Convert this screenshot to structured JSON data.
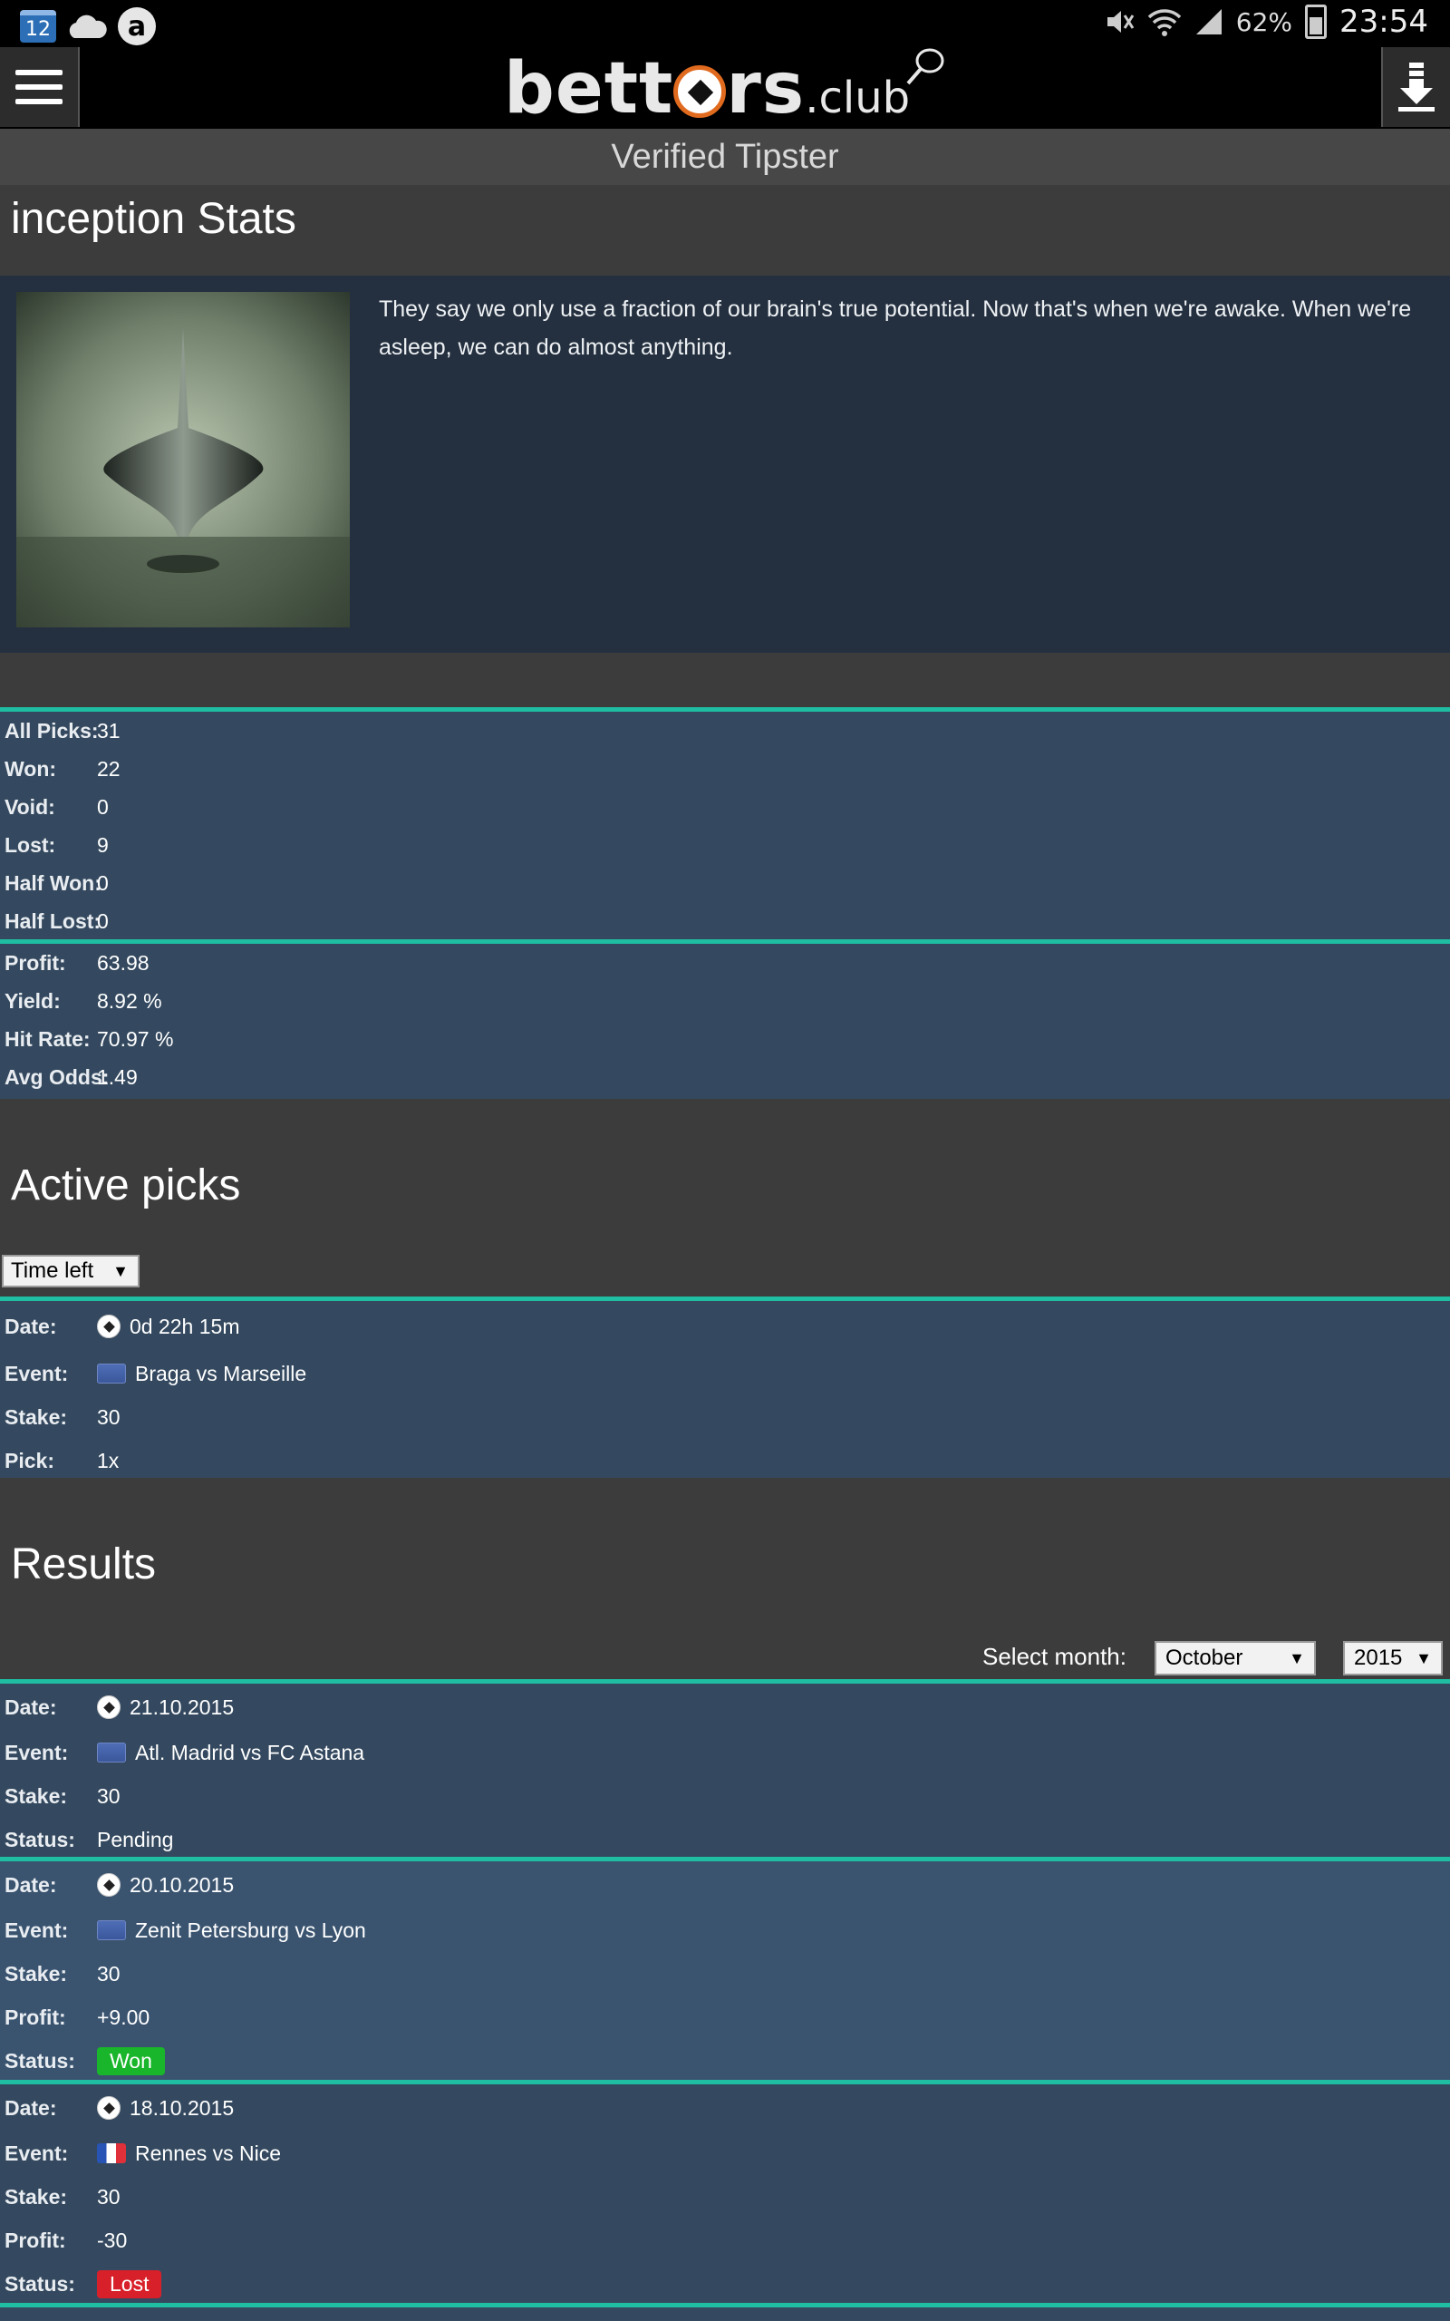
{
  "status_bar": {
    "calendar_day": "12",
    "battery": "62%",
    "time": "23:54"
  },
  "header": {
    "logo_text": "bett",
    "logo_rest": "rs",
    "logo_club": ".club"
  },
  "page": {
    "banner": "Verified Tipster",
    "title": "inception Stats"
  },
  "profile": {
    "bio": "They say we only use a fraction of our brain's true potential. Now that's when we're awake. When we're asleep, we can do almost anything."
  },
  "stats": {
    "picks": [
      {
        "label": "All Picks:",
        "value": "31"
      },
      {
        "label": "Won:",
        "value": "22"
      },
      {
        "label": "Void:",
        "value": "0"
      },
      {
        "label": "Lost:",
        "value": "9"
      },
      {
        "label": "Half Won:",
        "value": "0"
      },
      {
        "label": "Half Lost:",
        "value": "0"
      }
    ],
    "performance": [
      {
        "label": "Profit:",
        "value": "63.98"
      },
      {
        "label": "Yield:",
        "value": "8.92 %"
      },
      {
        "label": "Hit Rate:",
        "value": "70.97 %"
      },
      {
        "label": "Avg Odds:",
        "value": "1.49"
      }
    ]
  },
  "active": {
    "heading": "Active picks",
    "sort_select": "Time left",
    "pick": {
      "date_label": "Date:",
      "date": "0d 22h 15m",
      "event_label": "Event:",
      "event": "Braga vs Marseille",
      "stake_label": "Stake:",
      "stake": "30",
      "pick_label": "Pick:",
      "pick": "1x"
    }
  },
  "results": {
    "heading": "Results",
    "select_month_label": "Select month:",
    "month": "October",
    "year": "2015",
    "items": [
      {
        "date_label": "Date:",
        "date": "21.10.2015",
        "event_label": "Event:",
        "event": "Atl. Madrid vs FC Astana",
        "stake_label": "Stake:",
        "stake": "30",
        "status_label": "Status:",
        "status": "Pending"
      },
      {
        "date_label": "Date:",
        "date": "20.10.2015",
        "event_label": "Event:",
        "event": "Zenit Petersburg vs Lyon",
        "stake_label": "Stake:",
        "stake": "30",
        "profit_label": "Profit:",
        "profit": "+9.00",
        "status_label": "Status:",
        "status": "Won"
      },
      {
        "date_label": "Date:",
        "date": "18.10.2015",
        "event_label": "Event:",
        "event": "Rennes vs Nice",
        "stake_label": "Stake:",
        "stake": "30",
        "profit_label": "Profit:",
        "profit": "-30",
        "status_label": "Status:",
        "status": "Lost"
      }
    ]
  },
  "colors": {
    "accent": "#1fbda2",
    "panel": "#34495f",
    "won": "#19b52a",
    "lost": "#d8202a"
  }
}
